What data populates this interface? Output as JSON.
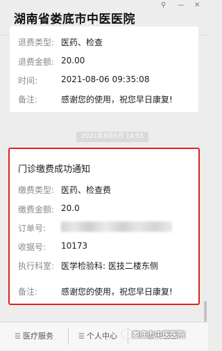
{
  "window": {
    "pin_glyph": "⚲",
    "min_glyph": "—",
    "close_glyph": "✕"
  },
  "header": {
    "title": "湖南省娄底市中医医院"
  },
  "refund_card": {
    "rows": [
      {
        "label": "退费类型:",
        "value": "医药、检查"
      },
      {
        "label": "退费金额:",
        "value": "20.00"
      },
      {
        "label": "时间:",
        "value": "2021-08-06 09:35:08"
      },
      {
        "label": "备注:",
        "value": "感谢您的使用，祝您早日康复!"
      }
    ]
  },
  "timestamp": "2021年8月6日 14:55",
  "payment_card": {
    "title": "门诊缴费成功通知",
    "rows": [
      {
        "label": "缴费类型:",
        "value": "医药、检查费"
      },
      {
        "label": "缴费金额:",
        "value": "20.0"
      },
      {
        "label": "订单号:",
        "value": ""
      },
      {
        "label": "收据号:",
        "value": "10173"
      },
      {
        "label": "执行科室:",
        "value": "医学检验科: 医技二楼东侧"
      },
      {
        "label": "备注:",
        "value": "感谢您的使用，祝您早日康复!"
      }
    ]
  },
  "bottom_menu": {
    "items": [
      {
        "label": "医疗服务"
      },
      {
        "label": "个人中心"
      },
      {
        "label": "医院信息"
      }
    ]
  },
  "watermark": "娄底市中医医院",
  "colors": {
    "highlight_border": "#e02020",
    "background": "#ededed"
  }
}
